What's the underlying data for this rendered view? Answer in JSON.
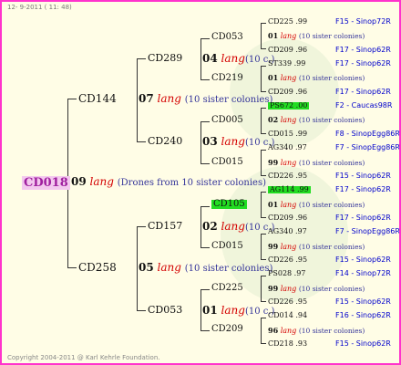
{
  "header": "12- 9-2011 ( 11: 48)",
  "footer": "Copyright 2004-2011 @ Karl Kehrle Foundation.",
  "colors": {
    "border": "#ff33cc",
    "background": "#fffde6",
    "root_highlight": "#f3c8ee",
    "lang": "#d40000",
    "station": "#0000cc",
    "green_box": "#22dd22"
  },
  "root": {
    "id": "CD018"
  },
  "gen1": {
    "num": "09",
    "lang": "lang",
    "note": "(Drones from 10 sister colonies)",
    "upper": {
      "id": "CD144"
    },
    "lower": {
      "id": "CD258"
    }
  },
  "gen2": [
    {
      "id": "CD289",
      "num": "04",
      "lang": "lang",
      "note": "(10 c.)"
    },
    {
      "id": "CD240",
      "num": "03",
      "lang": "lang",
      "note": "(10 c.)"
    },
    {
      "id": "CD157",
      "num": "02",
      "lang": "lang",
      "note": "(10 c.)"
    },
    {
      "id": "CD053",
      "num": "01",
      "lang": "lang",
      "note": "(10 c.)"
    }
  ],
  "gen2_mates": [
    {
      "num": "07",
      "lang": "lang",
      "note": "(10 sister colonies)"
    },
    {
      "num": "05",
      "lang": "lang",
      "note": "(10 sister colonies)"
    }
  ],
  "gen3": [
    {
      "id": "CD053"
    },
    {
      "id": "CD219"
    },
    {
      "id": "CD005"
    },
    {
      "id": "CD015"
    },
    {
      "id": "CD105"
    },
    {
      "id": "CD015"
    },
    {
      "id": "CD225"
    },
    {
      "id": "CD209"
    }
  ],
  "rows": [
    {
      "id": "CD225 .99",
      "station": "F15 - Sinop72R"
    },
    {
      "num": "01",
      "lang": "lang",
      "note": "(10 sister colonies)"
    },
    {
      "id": "CD209 .96",
      "station": "F17 - Sinop62R"
    },
    {
      "id": "ST339 .99",
      "station": "F17 - Sinop62R"
    },
    {
      "num": "01",
      "lang": "lang",
      "note": "(10 sister colonies)"
    },
    {
      "id": "CD209 .96",
      "station": "F17 - Sinop62R"
    },
    {
      "id": "PS672 .00",
      "station": "F2 - Caucas98R"
    },
    {
      "num": "02",
      "lang": "lang",
      "note": "(10 sister colonies)"
    },
    {
      "id": "CD015 .99",
      "station": "F8 - SinopEgg86R"
    },
    {
      "id": "AG340 .97",
      "station": "F7 - SinopEgg86R"
    },
    {
      "num": "99",
      "lang": "lang",
      "note": "(10 sister colonies)"
    },
    {
      "id": "CD226 .95",
      "station": "F15 - Sinop62R"
    },
    {
      "id": "AG114 .99",
      "station": "F17 - Sinop62R"
    },
    {
      "num": "01",
      "lang": "lang",
      "note": "(10 sister colonies)"
    },
    {
      "id": "CD209 .96",
      "station": "F17 - Sinop62R"
    },
    {
      "id": "AG340 .97",
      "station": "F7 - SinopEgg86R"
    },
    {
      "num": "99",
      "lang": "lang",
      "note": "(10 sister colonies)"
    },
    {
      "id": "CD226 .95",
      "station": "F15 - Sinop62R"
    },
    {
      "id": "PS028 .97",
      "station": "F14 - Sinop72R"
    },
    {
      "num": "99",
      "lang": "lang",
      "note": "(10 sister colonies)"
    },
    {
      "id": "CD226 .95",
      "station": "F15 - Sinop62R"
    },
    {
      "id": "CD014 .94",
      "station": "F16 - Sinop62R"
    },
    {
      "num": "96",
      "lang": "lang",
      "note": "(10 sister colonies)"
    },
    {
      "id": "CD218 .93",
      "station": "F15 - Sinop62R"
    }
  ]
}
